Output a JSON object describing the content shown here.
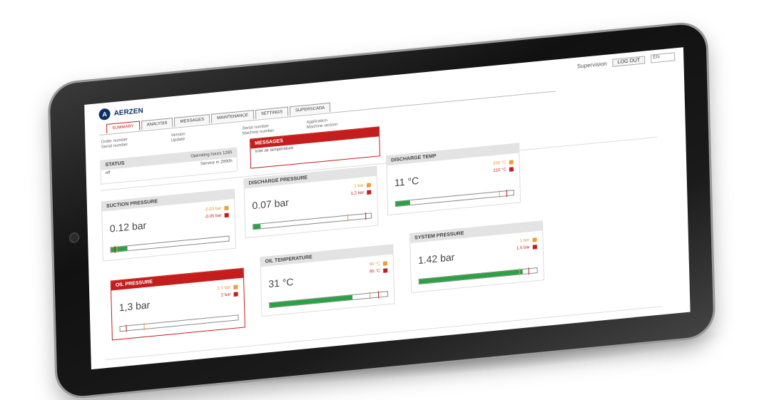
{
  "header": {
    "user_label": "Supervision",
    "logout_label": "LOG OUT",
    "lang_value": "EN"
  },
  "logo": {
    "text": "AERZEN"
  },
  "tabs": [
    {
      "label": "SUMMARY",
      "active": true
    },
    {
      "label": "ANALYSIS",
      "active": false
    },
    {
      "label": "MESSAGES",
      "active": false
    },
    {
      "label": "MAINTENANCE",
      "active": false
    },
    {
      "label": "SETTINGS",
      "active": false
    },
    {
      "label": "SUPERSCADA",
      "active": false
    }
  ],
  "info": {
    "col1": [
      "Order number",
      "Serial number"
    ],
    "col2": [
      "Version",
      "Update"
    ],
    "col3": [
      "Serial number",
      "Machine number"
    ],
    "col4": [
      "Application",
      "Machine version"
    ]
  },
  "status": {
    "title": "STATUS",
    "hours_label": "Operating hours",
    "hours_value": "1265",
    "service_label": "Service in",
    "service_value": "2890h",
    "state": "off"
  },
  "messages": {
    "title": "MESSAGES",
    "item": "Inlet air temperature"
  },
  "gauges": [
    {
      "id": "suction",
      "title": "SUCTION PRESSURE",
      "value": "0.12 bar",
      "warn": "-0.03 bar",
      "alarm": "-0.05 bar",
      "fill": 0.14,
      "warn_pos": 0.05,
      "alarm_pos": 0.03,
      "alert": false
    },
    {
      "id": "discharge",
      "title": "DISCHARGE PRESSURE",
      "value": "0.07 bar",
      "warn": "1 bar",
      "alarm": "1.2 bar",
      "fill": 0.06,
      "warn_pos": 0.8,
      "alarm_pos": 0.95,
      "alert": false
    },
    {
      "id": "disctemp",
      "title": "DISCHARGE TEMP",
      "value": "11 °C",
      "warn": "200 °C",
      "alarm": "210 °C",
      "fill": 0.12,
      "warn_pos": 0.88,
      "alarm_pos": 0.94,
      "alert": false
    },
    {
      "id": "oilpress",
      "title": "OIL PRESSURE",
      "value": "1,3 bar",
      "warn": "2.5 bar",
      "alarm": "2 bar",
      "fill": 0.0,
      "warn_pos": 0.2,
      "alarm_pos": 0.05,
      "alert": true
    },
    {
      "id": "oiltemp",
      "title": "OIL TEMPERATURE",
      "value": "31 °C",
      "warn": "90 °C",
      "alarm": "95 °C",
      "fill": 0.7,
      "warn_pos": 0.85,
      "alarm_pos": 0.92,
      "alert": false
    },
    {
      "id": "syspress",
      "title": "SYSTEM PRESSURE",
      "value": "1.42 bar",
      "warn": "1 bar",
      "alarm": "1.5 bar",
      "fill": 0.88,
      "warn_pos": 0.85,
      "alarm_pos": 0.93,
      "alert": false
    }
  ],
  "colors": {
    "accent": "#c51d1d",
    "ok": "#2aa143",
    "warn": "#e8a13a"
  }
}
